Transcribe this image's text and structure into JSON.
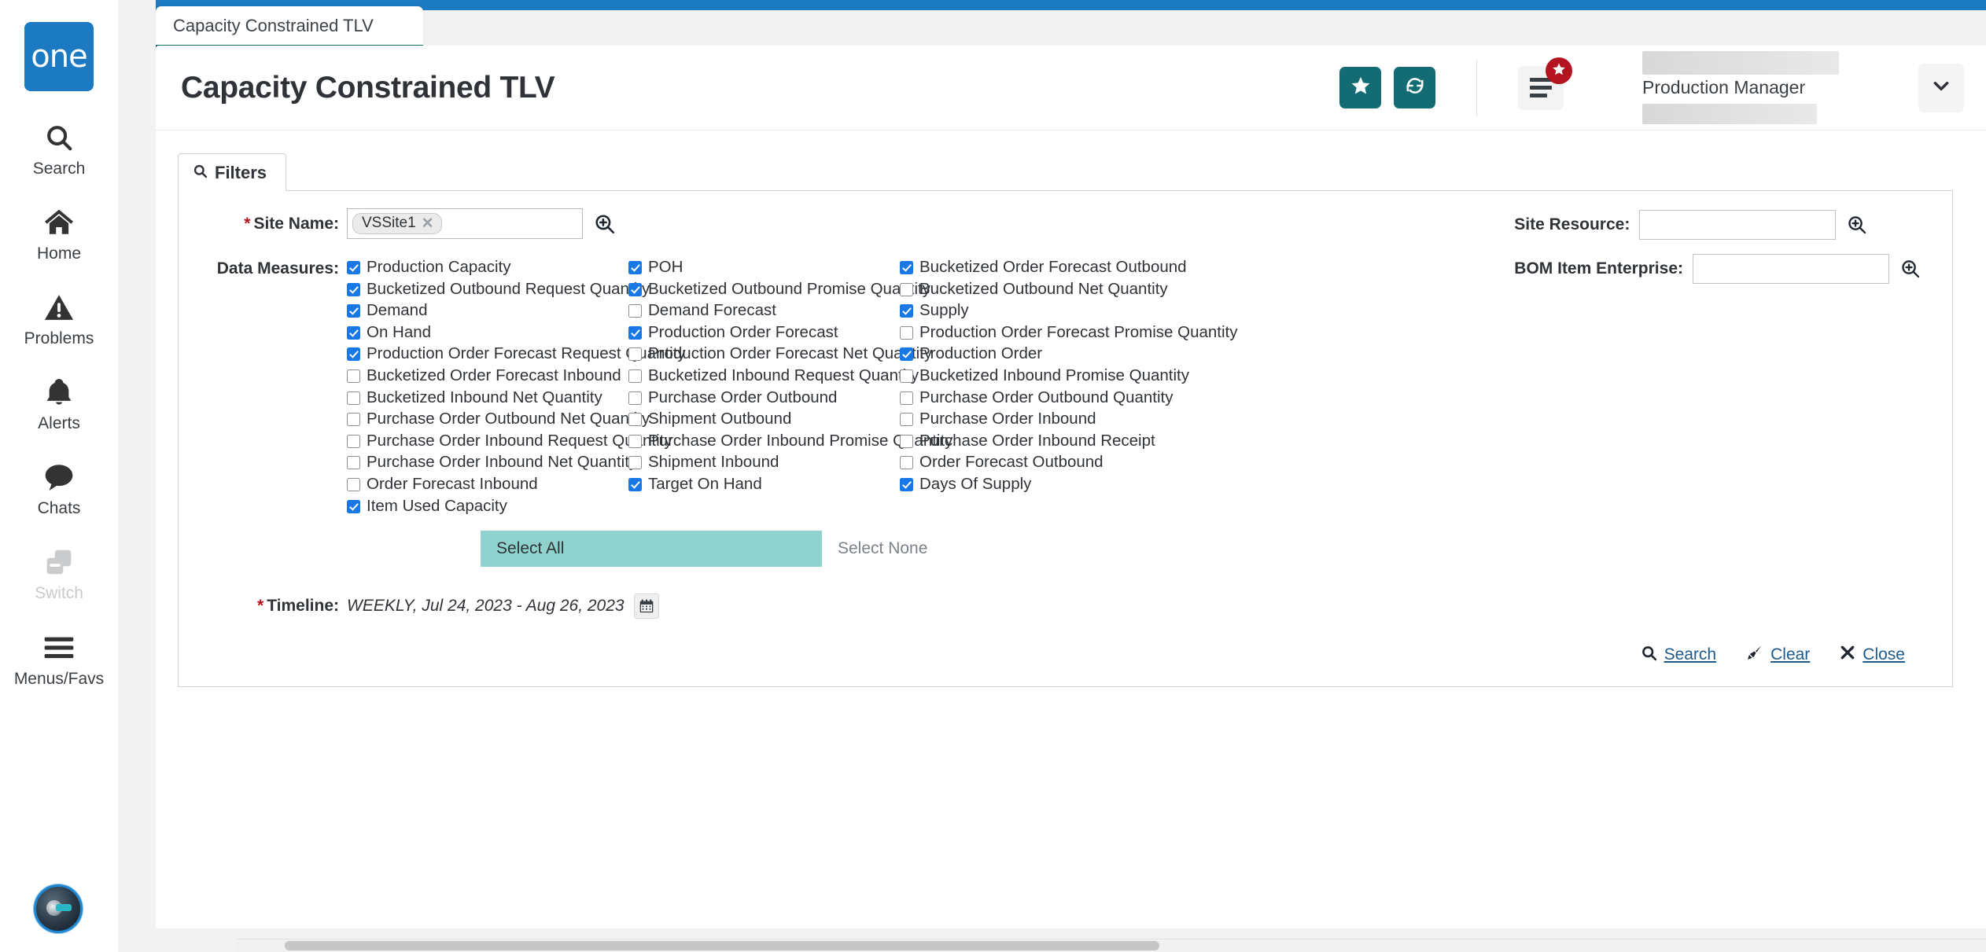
{
  "brand": {
    "logo_text": "one"
  },
  "sidebar": {
    "items": [
      {
        "label": "Search",
        "icon": "search-icon",
        "disabled": false
      },
      {
        "label": "Home",
        "icon": "home-icon",
        "disabled": false
      },
      {
        "label": "Problems",
        "icon": "warning-icon",
        "disabled": false
      },
      {
        "label": "Alerts",
        "icon": "bell-icon",
        "disabled": false
      },
      {
        "label": "Chats",
        "icon": "chat-icon",
        "disabled": false
      },
      {
        "label": "Switch",
        "icon": "switch-icon",
        "disabled": true
      },
      {
        "label": "Menus/Favs",
        "icon": "hamburger-icon",
        "disabled": false
      }
    ],
    "avatar": "assistant-avatar"
  },
  "tab": {
    "label": "Capacity Constrained TLV"
  },
  "header": {
    "title": "Capacity Constrained TLV",
    "favorite_icon": "star-icon",
    "refresh_icon": "refresh-icon",
    "menu_icon": "list-menu-icon",
    "menu_badge_icon": "star-icon",
    "user_role": "Production Manager",
    "user_dropdown_icon": "chevron-down-icon"
  },
  "filters": {
    "tab_label": "Filters",
    "tab_icon": "search-icon",
    "site_name": {
      "label": "Site Name:",
      "required": true,
      "tokens": [
        "VSSite1"
      ],
      "lookup_icon": "magnify-plus-icon"
    },
    "site_resource": {
      "label": "Site Resource:",
      "value": "",
      "lookup_icon": "magnify-plus-icon"
    },
    "bom_item_enterprise": {
      "label": "BOM Item Enterprise:",
      "value": "",
      "lookup_icon": "magnify-plus-icon"
    },
    "data_measures": {
      "label": "Data Measures:",
      "columns": [
        [
          {
            "label": "Production Capacity",
            "checked": true
          },
          {
            "label": "Bucketized Outbound Request Quantity",
            "checked": true
          },
          {
            "label": "Demand",
            "checked": true
          },
          {
            "label": "On Hand",
            "checked": true
          },
          {
            "label": "Production Order Forecast Request Quantity",
            "checked": true
          },
          {
            "label": "Bucketized Order Forecast Inbound",
            "checked": false
          },
          {
            "label": "Bucketized Inbound Net Quantity",
            "checked": false
          },
          {
            "label": "Purchase Order Outbound Net Quantity",
            "checked": false
          },
          {
            "label": "Purchase Order Inbound Request Quantity",
            "checked": false
          },
          {
            "label": "Purchase Order Inbound Net Quantity",
            "checked": false
          },
          {
            "label": "Order Forecast Inbound",
            "checked": false
          },
          {
            "label": "Item Used Capacity",
            "checked": true
          }
        ],
        [
          {
            "label": "POH",
            "checked": true
          },
          {
            "label": "Bucketized Outbound Promise Quantity",
            "checked": true
          },
          {
            "label": "Demand Forecast",
            "checked": false
          },
          {
            "label": "Production Order Forecast",
            "checked": true
          },
          {
            "label": "Production Order Forecast Net Quantity",
            "checked": false
          },
          {
            "label": "Bucketized Inbound Request Quantity",
            "checked": false
          },
          {
            "label": "Purchase Order Outbound",
            "checked": false
          },
          {
            "label": "Shipment Outbound",
            "checked": false
          },
          {
            "label": "Purchase Order Inbound Promise Quantity",
            "checked": false
          },
          {
            "label": "Shipment Inbound",
            "checked": false
          },
          {
            "label": "Target On Hand",
            "checked": true
          }
        ],
        [
          {
            "label": "Bucketized Order Forecast Outbound",
            "checked": true
          },
          {
            "label": "Bucketized Outbound Net Quantity",
            "checked": false
          },
          {
            "label": "Supply",
            "checked": true
          },
          {
            "label": "Production Order Forecast Promise Quantity",
            "checked": false
          },
          {
            "label": "Production Order",
            "checked": true
          },
          {
            "label": "Bucketized Inbound Promise Quantity",
            "checked": false
          },
          {
            "label": "Purchase Order Outbound Quantity",
            "checked": false
          },
          {
            "label": "Purchase Order Inbound",
            "checked": false
          },
          {
            "label": "Purchase Order Inbound Receipt",
            "checked": false
          },
          {
            "label": "Order Forecast Outbound",
            "checked": false
          },
          {
            "label": "Days Of Supply",
            "checked": true
          }
        ]
      ]
    },
    "select_all_label": "Select All",
    "select_none_label": "Select None",
    "timeline": {
      "label": "Timeline:",
      "required": true,
      "value": "WEEKLY, Jul 24, 2023 - Aug 26, 2023",
      "calendar_icon": "calendar-icon"
    },
    "actions": [
      {
        "label": "Search",
        "icon": "search-icon"
      },
      {
        "label": "Clear",
        "icon": "broom-icon"
      },
      {
        "label": "Close",
        "icon": "close-x-icon"
      }
    ]
  },
  "colors": {
    "brand_blue": "#1b7ac2",
    "teal_button": "#136c74",
    "tab_underline": "#136c74",
    "checkbox_blue": "#1878e6",
    "select_all_bg": "#90d2ce",
    "badge_red": "#b3141f",
    "link_blue": "#1d5a8c",
    "required_red": "#b3141f"
  }
}
